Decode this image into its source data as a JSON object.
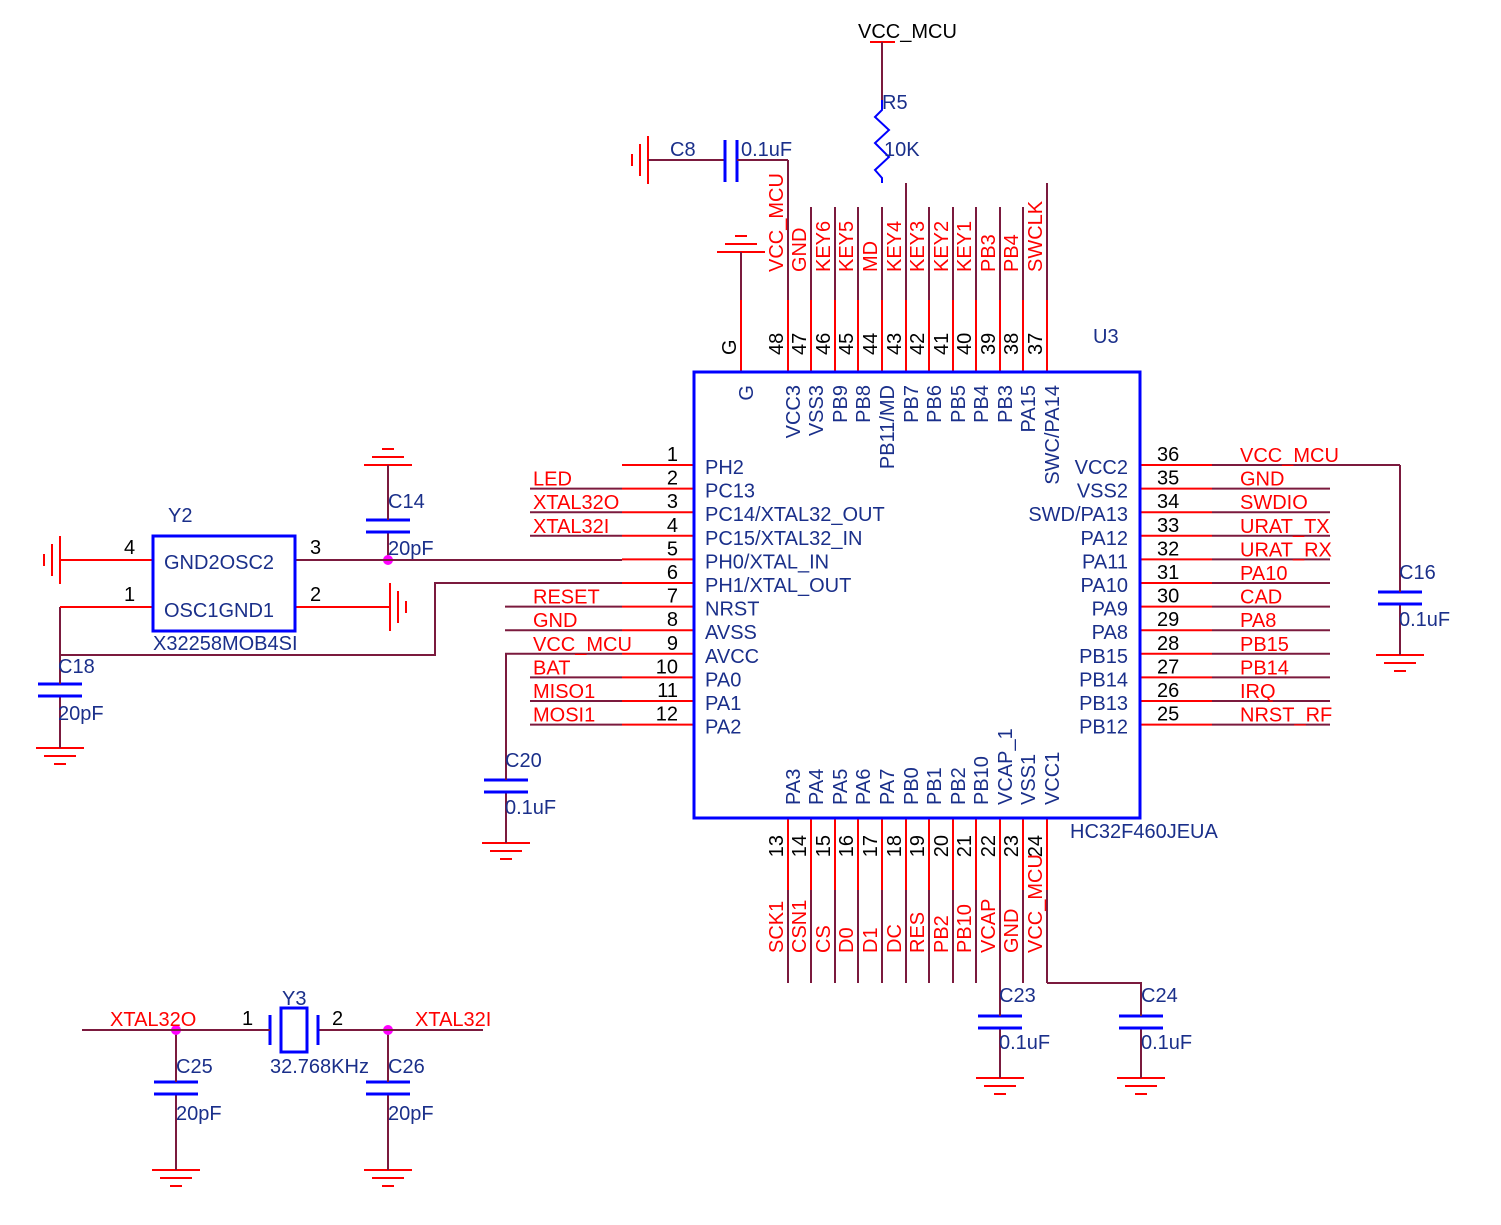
{
  "colors": {
    "pin": "#ff0000",
    "wire": "#7b1a3e",
    "body": "#0000ff",
    "label": "#1a2f8a",
    "net": "#ff0000",
    "number": "#000000",
    "junction": "#ff00ff"
  },
  "chip": {
    "ref": "U3",
    "part": "HC32F460JEUA",
    "top_pins": [
      {
        "num": "G",
        "name": "G",
        "net": ""
      },
      {
        "num": "48",
        "name": "VCC3",
        "net": "VCC_MCU"
      },
      {
        "num": "47",
        "name": "VSS3",
        "net": "GND"
      },
      {
        "num": "46",
        "name": "PB9",
        "net": "KEY6"
      },
      {
        "num": "45",
        "name": "PB8",
        "net": "KEY5"
      },
      {
        "num": "44",
        "name": "PB11/MD",
        "net": "MD"
      },
      {
        "num": "43",
        "name": "PB7",
        "net": "KEY4"
      },
      {
        "num": "42",
        "name": "PB6",
        "net": "KEY3"
      },
      {
        "num": "41",
        "name": "PB5",
        "net": "KEY2"
      },
      {
        "num": "40",
        "name": "PB4",
        "net": "KEY1"
      },
      {
        "num": "39",
        "name": "PB3",
        "net": "PB3"
      },
      {
        "num": "38",
        "name": "PA15",
        "net": "PB4"
      },
      {
        "num": "37",
        "name": "SWC/PA14",
        "net": "SWCLK"
      }
    ],
    "left_pins": [
      {
        "num": "1",
        "name": "PH2",
        "net": ""
      },
      {
        "num": "2",
        "name": "PC13",
        "net": "LED"
      },
      {
        "num": "3",
        "name": "PC14/XTAL32_OUT",
        "net": "XTAL32O"
      },
      {
        "num": "4",
        "name": "PC15/XTAL32_IN",
        "net": "XTAL32I"
      },
      {
        "num": "5",
        "name": "PH0/XTAL_IN",
        "net": ""
      },
      {
        "num": "6",
        "name": "PH1/XTAL_OUT",
        "net": ""
      },
      {
        "num": "7",
        "name": "NRST",
        "net": "RESET"
      },
      {
        "num": "8",
        "name": "AVSS",
        "net": "GND"
      },
      {
        "num": "9",
        "name": "AVCC",
        "net": "VCC_MCU"
      },
      {
        "num": "10",
        "name": "PA0",
        "net": "BAT"
      },
      {
        "num": "11",
        "name": "PA1",
        "net": "MISO1"
      },
      {
        "num": "12",
        "name": "PA2",
        "net": "MOSI1"
      }
    ],
    "right_pins": [
      {
        "num": "36",
        "name": "VCC2",
        "net": "VCC_MCU"
      },
      {
        "num": "35",
        "name": "VSS2",
        "net": "GND"
      },
      {
        "num": "34",
        "name": "SWD/PA13",
        "net": "SWDIO"
      },
      {
        "num": "33",
        "name": "PA12",
        "net": "URAT_TX"
      },
      {
        "num": "32",
        "name": "PA11",
        "net": "URAT_RX"
      },
      {
        "num": "31",
        "name": "PA10",
        "net": "PA10"
      },
      {
        "num": "30",
        "name": "PA9",
        "net": "CAD"
      },
      {
        "num": "29",
        "name": "PA8",
        "net": "PA8"
      },
      {
        "num": "28",
        "name": "PB15",
        "net": "PB15"
      },
      {
        "num": "27",
        "name": "PB14",
        "net": "PB14"
      },
      {
        "num": "26",
        "name": "PB13",
        "net": "IRQ"
      },
      {
        "num": "25",
        "name": "PB12",
        "net": "NRST_RF"
      }
    ],
    "bottom_pins": [
      {
        "num": "13",
        "name": "PA3",
        "net": "SCK1"
      },
      {
        "num": "14",
        "name": "PA4",
        "net": "CSN1"
      },
      {
        "num": "15",
        "name": "PA5",
        "net": "CS"
      },
      {
        "num": "16",
        "name": "PA6",
        "net": "D0"
      },
      {
        "num": "17",
        "name": "PA7",
        "net": "D1"
      },
      {
        "num": "18",
        "name": "PB0",
        "net": "DC"
      },
      {
        "num": "19",
        "name": "PB1",
        "net": "RES"
      },
      {
        "num": "20",
        "name": "PB2",
        "net": "PB2"
      },
      {
        "num": "21",
        "name": "PB10",
        "net": "PB10"
      },
      {
        "num": "22",
        "name": "VCAP_1",
        "net": "VCAP"
      },
      {
        "num": "23",
        "name": "VSS1",
        "net": "GND"
      },
      {
        "num": "24",
        "name": "VCC1",
        "net": "VCC_MCU"
      }
    ]
  },
  "power_label": "VCC_MCU",
  "r5": {
    "ref": "R5",
    "value": "10K"
  },
  "c8": {
    "ref": "C8",
    "value": "0.1uF"
  },
  "c14": {
    "ref": "C14",
    "value": "20pF"
  },
  "c18": {
    "ref": "C18",
    "value": "20pF"
  },
  "c20": {
    "ref": "C20",
    "value": "0.1uF"
  },
  "c16": {
    "ref": "C16",
    "value": "0.1uF"
  },
  "c23": {
    "ref": "C23",
    "value": "0.1uF"
  },
  "c24": {
    "ref": "C24",
    "value": "0.1uF"
  },
  "c25": {
    "ref": "C25",
    "value": "20pF"
  },
  "c26": {
    "ref": "C26",
    "value": "20pF"
  },
  "y2": {
    "ref": "Y2",
    "part": "X32258MOB4SI",
    "pin_names_top": "GND2OSC2",
    "pin_names_bottom": "OSC1GND1",
    "pins": [
      "4",
      "3",
      "1",
      "2"
    ]
  },
  "y3": {
    "ref": "Y3",
    "value": "32.768KHz",
    "pins": [
      "1",
      "2"
    ],
    "net_left": "XTAL32O",
    "net_right": "XTAL32I"
  }
}
